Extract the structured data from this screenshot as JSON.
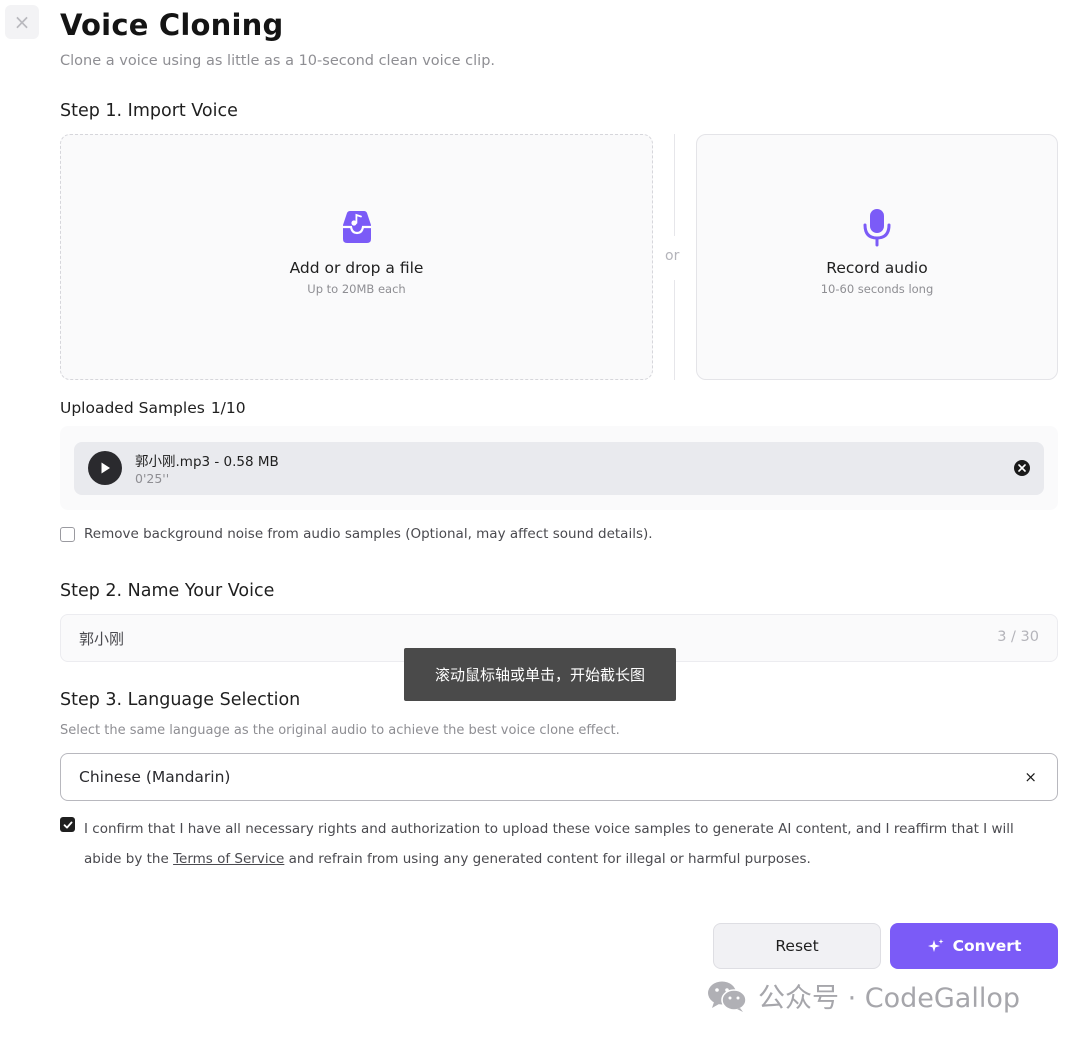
{
  "header": {
    "close_icon": "×",
    "title": "Voice Cloning",
    "subtitle": "Clone a voice using as little as a 10-second clean voice clip."
  },
  "step1": {
    "heading": "Step 1. Import Voice",
    "upload": {
      "title": "Add or drop a file",
      "subtitle": "Up to 20MB each",
      "icon": "music-file-inbox-icon"
    },
    "divider_text": "or",
    "record": {
      "title": "Record audio",
      "subtitle": "10-60 seconds long",
      "icon": "microphone-icon"
    },
    "uploaded_label": "Uploaded Samples",
    "uploaded_count": "1/10",
    "samples": [
      {
        "name": "郭小刚.mp3 - 0.58 MB",
        "duration": "0'25''"
      }
    ],
    "noise_option": {
      "label": "Remove background noise from audio samples (Optional, may affect sound details).",
      "checked": false
    }
  },
  "step2": {
    "heading": "Step 2. Name Your Voice",
    "value": "郭小刚",
    "count": "3 / 30"
  },
  "tooltip": "滚动鼠标轴或单击，开始截长图",
  "step3": {
    "heading": "Step 3. Language Selection",
    "description": "Select the same language as the original audio to achieve the best voice clone effect.",
    "selected": "Chinese (Mandarin)",
    "clear_icon": "×"
  },
  "consent": {
    "checked": true,
    "text_before": "I confirm that I have all necessary rights and authorization to upload these voice samples to generate AI content, and I reaffirm that I will abide by the ",
    "link": "Terms of Service",
    "text_after": " and refrain from using any generated content for illegal or harmful purposes."
  },
  "actions": {
    "reset": "Reset",
    "convert": "Convert"
  },
  "watermark": "公众号 · CodeGallop",
  "colors": {
    "accent": "#7b5bf7",
    "sample_bg": "#e9eaee",
    "tooltip_bg": "#4a4a4a"
  }
}
